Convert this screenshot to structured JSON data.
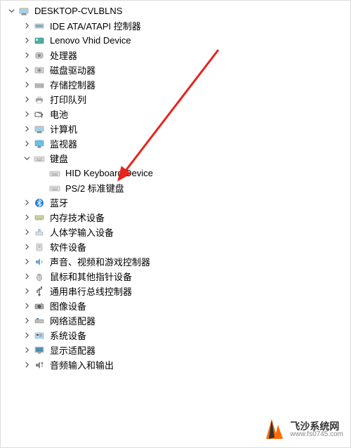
{
  "root": {
    "label": "DESKTOP-CVLBLNS"
  },
  "categories": [
    {
      "label": "IDE ATA/ATAPI 控制器",
      "icon": "ide"
    },
    {
      "label": "Lenovo Vhid Device",
      "icon": "pci"
    },
    {
      "label": "处理器",
      "icon": "cpu"
    },
    {
      "label": "磁盘驱动器",
      "icon": "disk"
    },
    {
      "label": "存储控制器",
      "icon": "storage"
    },
    {
      "label": "打印队列",
      "icon": "printer"
    },
    {
      "label": "电池",
      "icon": "battery"
    },
    {
      "label": "计算机",
      "icon": "computer"
    },
    {
      "label": "监视器",
      "icon": "monitor"
    }
  ],
  "keyboard": {
    "label": "键盘",
    "children": [
      {
        "label": "HID Keyboard Device"
      },
      {
        "label": "PS/2 标准键盘"
      }
    ]
  },
  "categories2": [
    {
      "label": "蓝牙",
      "icon": "bluetooth"
    },
    {
      "label": "内存技术设备",
      "icon": "memory"
    },
    {
      "label": "人体学输入设备",
      "icon": "hid"
    },
    {
      "label": "软件设备",
      "icon": "software"
    },
    {
      "label": "声音、视频和游戏控制器",
      "icon": "audio"
    },
    {
      "label": "鼠标和其他指针设备",
      "icon": "mouse"
    },
    {
      "label": "通用串行总线控制器",
      "icon": "usb"
    },
    {
      "label": "图像设备",
      "icon": "camera"
    },
    {
      "label": "网络适配器",
      "icon": "network"
    },
    {
      "label": "系统设备",
      "icon": "system"
    },
    {
      "label": "显示适配器",
      "icon": "display"
    },
    {
      "label": "音频输入和输出",
      "icon": "audioio"
    }
  ],
  "watermark": {
    "cn": "飞沙系统网",
    "url": "www.fs0745.com"
  }
}
